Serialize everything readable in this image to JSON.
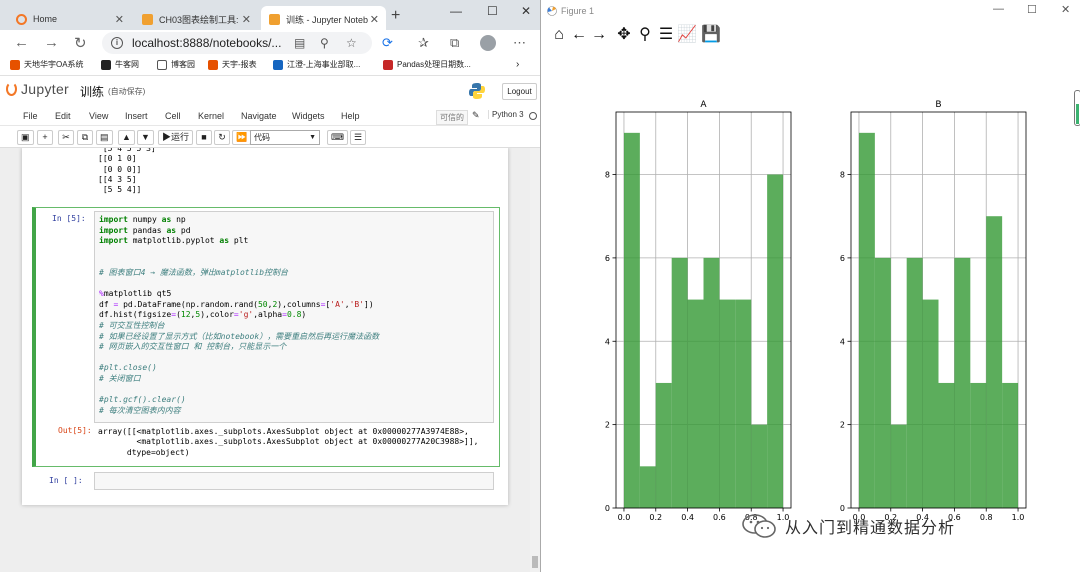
{
  "browser": {
    "tabs": [
      {
        "label": "Home",
        "active": false
      },
      {
        "label": "CH03图表绘制工具:",
        "active": false
      },
      {
        "label": "训练 - Jupyter Noteb",
        "active": true
      }
    ],
    "url": "localhost:8888/notebooks/...",
    "bookmarks": [
      "天地华宇OA系统",
      "牛客网",
      "博客园",
      "天宇-报表",
      "江澄-上海事业部取...",
      "Pandas处理日期数..."
    ]
  },
  "jupyter": {
    "logo_text": "Jupyter",
    "notebook_name": "训练",
    "autosave": "(自动保存)",
    "logout_label": "Logout",
    "menus": [
      "File",
      "Edit",
      "View",
      "Insert",
      "Cell",
      "Kernel",
      "Navigate",
      "Widgets",
      "Help"
    ],
    "trusted_label": "可信的",
    "kernel_label": "Python 3",
    "run_label": "运行",
    "cell_type": "代码",
    "prev_output": " [5 4 5 5 3]\n[[0 1 0]\n [0 0 0]]\n[[4 3 5]\n [5 5 4]]",
    "cell_prompt_in": "In  [5]:",
    "cell_prompt_out": "Out[5]:",
    "empty_prompt": "In  [ ]:",
    "output_text": "array([[<matplotlib.axes._subplots.AxesSubplot object at 0x00000277A3974E88>,\n        <matplotlib.axes._subplots.AxesSubplot object at 0x00000277A20C3988>]],\n      dtype=object)"
  },
  "figure": {
    "window_title": "Figure 1"
  },
  "chart_data": [
    {
      "type": "bar",
      "title": "A",
      "bin_edges": [
        0.0,
        0.1,
        0.2,
        0.3,
        0.4,
        0.5,
        0.6,
        0.7,
        0.8,
        0.9,
        1.0
      ],
      "values": [
        9,
        1,
        3,
        6,
        5,
        6,
        5,
        5,
        2,
        8
      ],
      "color": "#339933",
      "alpha": 0.8,
      "xlim": [
        -0.05,
        1.05
      ],
      "ylim": [
        0,
        9.5
      ],
      "xticks": [
        "0.0",
        "0.2",
        "0.4",
        "0.6",
        "0.8",
        "1.0"
      ],
      "yticks": [
        "0",
        "2",
        "4",
        "6",
        "8"
      ],
      "grid": true
    },
    {
      "type": "bar",
      "title": "B",
      "bin_edges": [
        0.0,
        0.1,
        0.2,
        0.3,
        0.4,
        0.5,
        0.6,
        0.7,
        0.8,
        0.9,
        1.0
      ],
      "values": [
        9,
        6,
        2,
        6,
        5,
        3,
        6,
        3,
        7,
        3
      ],
      "color": "#339933",
      "alpha": 0.8,
      "xlim": [
        -0.05,
        1.05
      ],
      "ylim": [
        0,
        9.5
      ],
      "xticks": [
        "0.0",
        "0.2",
        "0.4",
        "0.6",
        "0.8",
        "1.0"
      ],
      "yticks": [
        "0",
        "2",
        "4",
        "6",
        "8"
      ],
      "grid": true
    }
  ],
  "watermark": "从入门到精通数据分析"
}
